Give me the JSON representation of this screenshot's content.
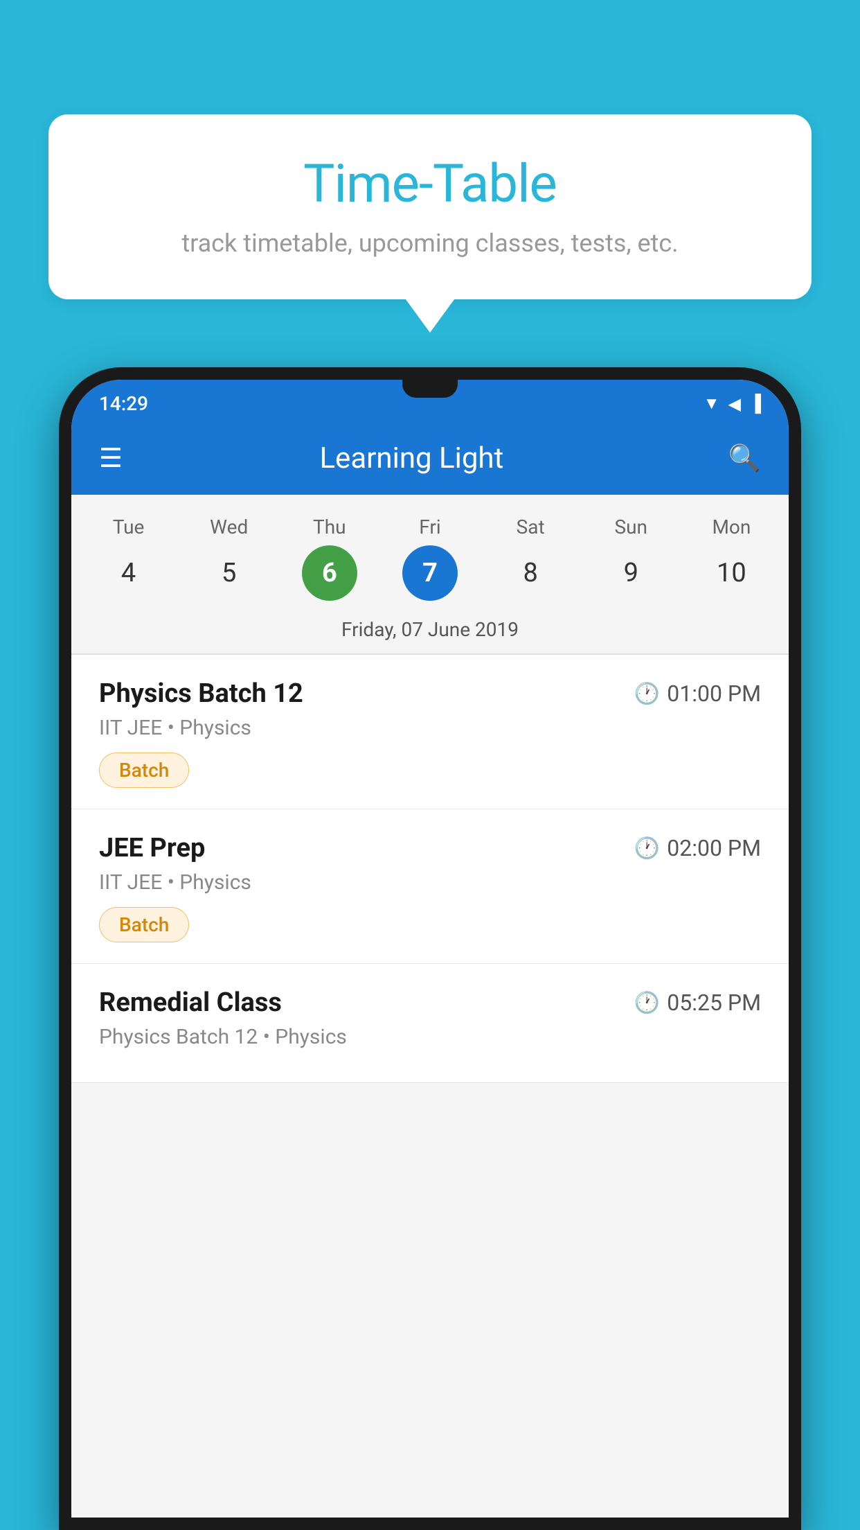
{
  "background_color": "#29b6d8",
  "tooltip": {
    "title": "Time-Table",
    "subtitle": "track timetable, upcoming classes, tests, etc."
  },
  "phone": {
    "status_bar": {
      "time": "14:29",
      "icons": [
        "▼",
        "◀",
        "▐"
      ]
    },
    "app_bar": {
      "title": "Learning Light",
      "menu_icon": "☰",
      "search_icon": "🔍"
    },
    "calendar": {
      "days": [
        {
          "label": "Tue",
          "number": "4"
        },
        {
          "label": "Wed",
          "number": "5"
        },
        {
          "label": "Thu",
          "number": "6",
          "state": "today"
        },
        {
          "label": "Fri",
          "number": "7",
          "state": "selected"
        },
        {
          "label": "Sat",
          "number": "8"
        },
        {
          "label": "Sun",
          "number": "9"
        },
        {
          "label": "Mon",
          "number": "10"
        }
      ],
      "selected_date_label": "Friday, 07 June 2019"
    },
    "schedule": [
      {
        "title": "Physics Batch 12",
        "time": "01:00 PM",
        "subtitle": "IIT JEE • Physics",
        "badge": "Batch"
      },
      {
        "title": "JEE Prep",
        "time": "02:00 PM",
        "subtitle": "IIT JEE • Physics",
        "badge": "Batch"
      },
      {
        "title": "Remedial Class",
        "time": "05:25 PM",
        "subtitle": "Physics Batch 12 • Physics",
        "badge": null
      }
    ]
  }
}
